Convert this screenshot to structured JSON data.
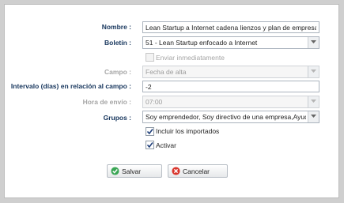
{
  "form": {
    "nombre": {
      "label": "Nombre :",
      "value": "Lean Startup a Internet cadena lienzos y plan de empresa"
    },
    "boletin": {
      "label": "Boletín :",
      "value": "51 - Lean Startup enfocado a Internet"
    },
    "enviar_inmediatamente": {
      "label": "Enviar inmediatamente",
      "checked": false,
      "enabled": false
    },
    "campo": {
      "label": "Campo :",
      "value": "Fecha de alta",
      "enabled": false
    },
    "intervalo": {
      "label": "Intervalo (días) en relación al campo :",
      "value": "-2"
    },
    "hora_envio": {
      "label": "Hora de envío :",
      "value": "07:00",
      "enabled": false
    },
    "grupos": {
      "label": "Grupos :",
      "value": "Soy emprendedor, Soy directivo de una empresa,Ayuda"
    },
    "incluir_importados": {
      "label": "Incluir los importados",
      "checked": true
    },
    "activar": {
      "label": "Activar",
      "checked": true
    }
  },
  "buttons": {
    "save": {
      "label": "Salvar",
      "icon": "check-icon",
      "color": "#3aa655"
    },
    "cancel": {
      "label": "Cancelar",
      "icon": "cancel-icon",
      "color": "#d9342b"
    }
  }
}
